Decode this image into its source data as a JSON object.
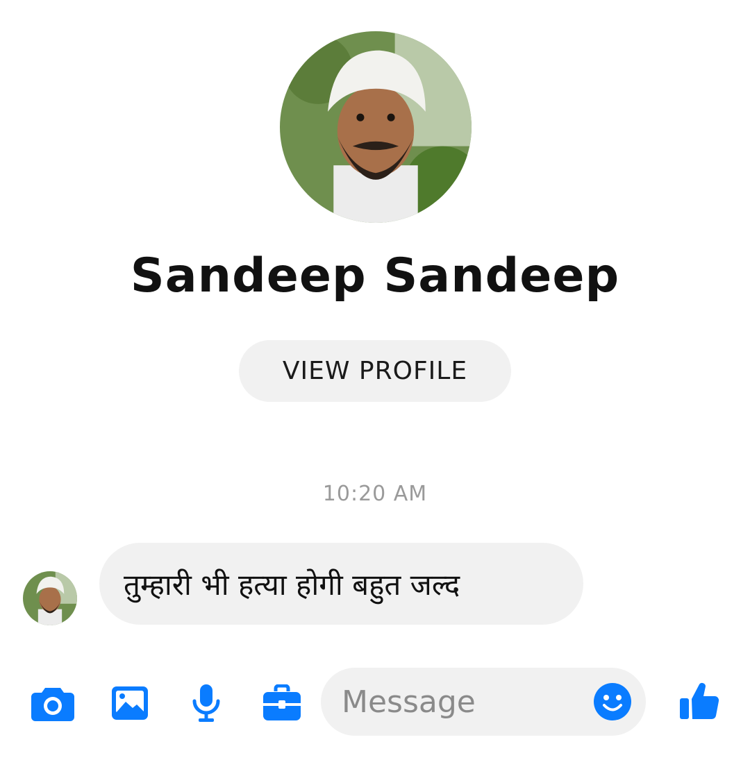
{
  "contact": {
    "name": "Sandeep Sandeep",
    "view_profile_label": "VIEW PROFILE"
  },
  "conversation": {
    "timestamp": "10:20 AM",
    "messages": [
      {
        "sender": "Sandeep Sandeep",
        "text": "तुम्हारी भी हत्या होगी बहुत जल्द"
      }
    ]
  },
  "composer": {
    "placeholder": "Message",
    "icons": [
      "camera-icon",
      "image-icon",
      "microphone-icon",
      "briefcase-icon",
      "emoji-icon",
      "thumbs-up-icon"
    ],
    "accent_color": "#0a7cff"
  }
}
